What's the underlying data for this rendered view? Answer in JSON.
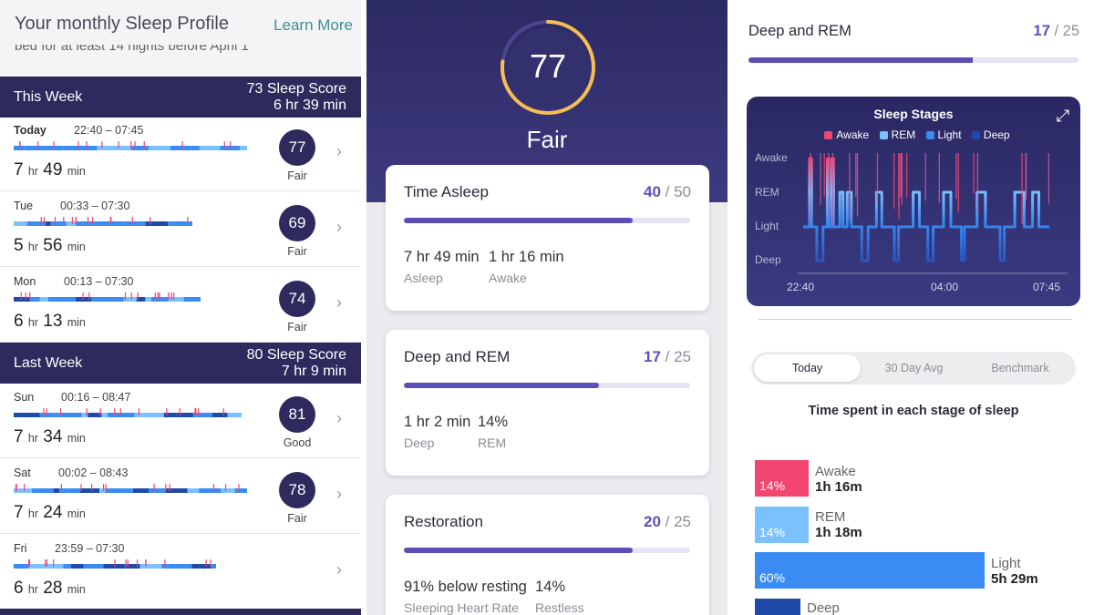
{
  "left": {
    "profile_title": "Your monthly Sleep Profile",
    "learn_more": "Learn More",
    "faded_text": "bed for at least 14 nights before April 1",
    "this_week": {
      "label": "This Week",
      "score_line": "73 Sleep Score",
      "duration_line": "6 hr 39 min"
    },
    "last_week": {
      "label": "Last Week",
      "score_line": "80 Sleep Score",
      "duration_line": "7 hr 9 min"
    },
    "days": [
      {
        "day": "Today",
        "range": "22:40 – 07:45",
        "hours": "7",
        "mins": "49",
        "score": "77",
        "rating": "Fair"
      },
      {
        "day": "Tue",
        "range": "00:33 – 07:30",
        "hours": "5",
        "mins": "56",
        "score": "69",
        "rating": "Fair"
      },
      {
        "day": "Mon",
        "range": "00:13 – 07:30",
        "hours": "6",
        "mins": "13",
        "score": "74",
        "rating": "Fair"
      },
      {
        "day": "Sun",
        "range": "00:16 – 08:47",
        "hours": "7",
        "mins": "34",
        "score": "81",
        "rating": "Good"
      },
      {
        "day": "Sat",
        "range": "00:02 – 08:43",
        "hours": "7",
        "mins": "24",
        "score": "78",
        "rating": "Fair"
      },
      {
        "day": "Fri",
        "range": "23:59 – 07:30",
        "hours": "6",
        "mins": "28",
        "score": "",
        "rating": ""
      }
    ],
    "hr_unit": "hr",
    "min_unit": "min"
  },
  "middle": {
    "score": "77",
    "score_progress": 0.77,
    "rating": "Fair",
    "cards": [
      {
        "title": "Time Asleep",
        "score": "40",
        "max": "50",
        "progress": 0.8,
        "metrics": [
          {
            "value": "7 hr 49 min",
            "label": "Asleep"
          },
          {
            "value": "1 hr 16 min",
            "label": "Awake"
          }
        ]
      },
      {
        "title": "Deep and REM",
        "score": "17",
        "max": "25",
        "progress": 0.68,
        "metrics": [
          {
            "value": "1 hr 2 min",
            "label": "Deep"
          },
          {
            "value": "14%",
            "label": "REM"
          }
        ]
      },
      {
        "title": "Restoration",
        "score": "20",
        "max": "25",
        "progress": 0.8,
        "metrics": [
          {
            "value": "91% below resting",
            "label": "Sleeping Heart Rate"
          },
          {
            "value": "14%",
            "label": "Restless"
          }
        ]
      }
    ]
  },
  "right": {
    "title": "Deep and REM",
    "score": "17",
    "max": "25",
    "progress": 0.68,
    "stages_title": "Sleep Stages",
    "legend": [
      {
        "name": "Awake",
        "color": "#f2456f"
      },
      {
        "name": "REM",
        "color": "#7cc1ff"
      },
      {
        "name": "Light",
        "color": "#3b8bf5"
      },
      {
        "name": "Deep",
        "color": "#1f4aa8"
      }
    ],
    "y_labels": [
      "Awake",
      "REM",
      "Light",
      "Deep"
    ],
    "x_labels": [
      "22:40",
      "04:00",
      "07:45"
    ],
    "tabs": [
      "Today",
      "30 Day Avg",
      "Benchmark"
    ],
    "active_tab": "Today",
    "spent_title": "Time spent in each stage of sleep",
    "breakdown": [
      {
        "name": "Awake",
        "pct": "14%",
        "time": "1h 16m",
        "fraction": 0.14,
        "color": "#f2456f"
      },
      {
        "name": "REM",
        "pct": "14%",
        "time": "1h 18m",
        "fraction": 0.14,
        "color": "#7cc1ff"
      },
      {
        "name": "Light",
        "pct": "60%",
        "time": "5h 29m",
        "fraction": 0.6,
        "color": "#3b8bf5"
      },
      {
        "name": "Deep",
        "pct": "",
        "time": "",
        "fraction": 0.12,
        "color": "#1f4aa8"
      }
    ]
  }
}
